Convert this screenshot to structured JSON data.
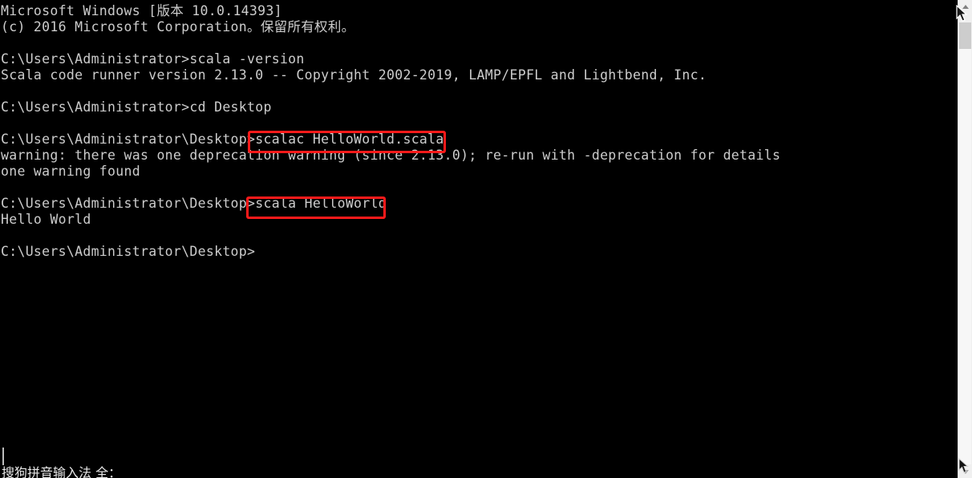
{
  "window": {
    "app": "Windows Command Prompt",
    "background_color": "#000000",
    "text_color": "#cccccc"
  },
  "console": {
    "lines": [
      "Microsoft Windows [版本 10.0.14393]",
      "(c) 2016 Microsoft Corporation。保留所有权利。",
      "",
      "C:\\Users\\Administrator>scala -version",
      "Scala code runner version 2.13.0 -- Copyright 2002-2019, LAMP/EPFL and Lightbend, Inc.",
      "",
      "C:\\Users\\Administrator>cd Desktop",
      "",
      "C:\\Users\\Administrator\\Desktop>scalac HelloWorld.scala",
      "warning: there was one deprecation warning (since 2.13.0); re-run with -deprecation for details",
      "one warning found",
      "",
      "C:\\Users\\Administrator\\Desktop>scala HelloWorld",
      "Hello World",
      "",
      "C:\\Users\\Administrator\\Desktop>"
    ]
  },
  "annotations": {
    "color": "#ff1a1a",
    "boxes": [
      {
        "id": "redbox-scalac",
        "label": "scalac HelloWorld.scala"
      },
      {
        "id": "redbox-scala-run",
        "label": "scala HelloWorld"
      }
    ]
  },
  "scrollbar": {
    "up_arrow": "scroll-up-arrow",
    "down_arrow": "scroll-down-arrow",
    "thumb": "scrollbar-thumb"
  },
  "ime": {
    "text": "搜狗拼音输入法 全："
  }
}
